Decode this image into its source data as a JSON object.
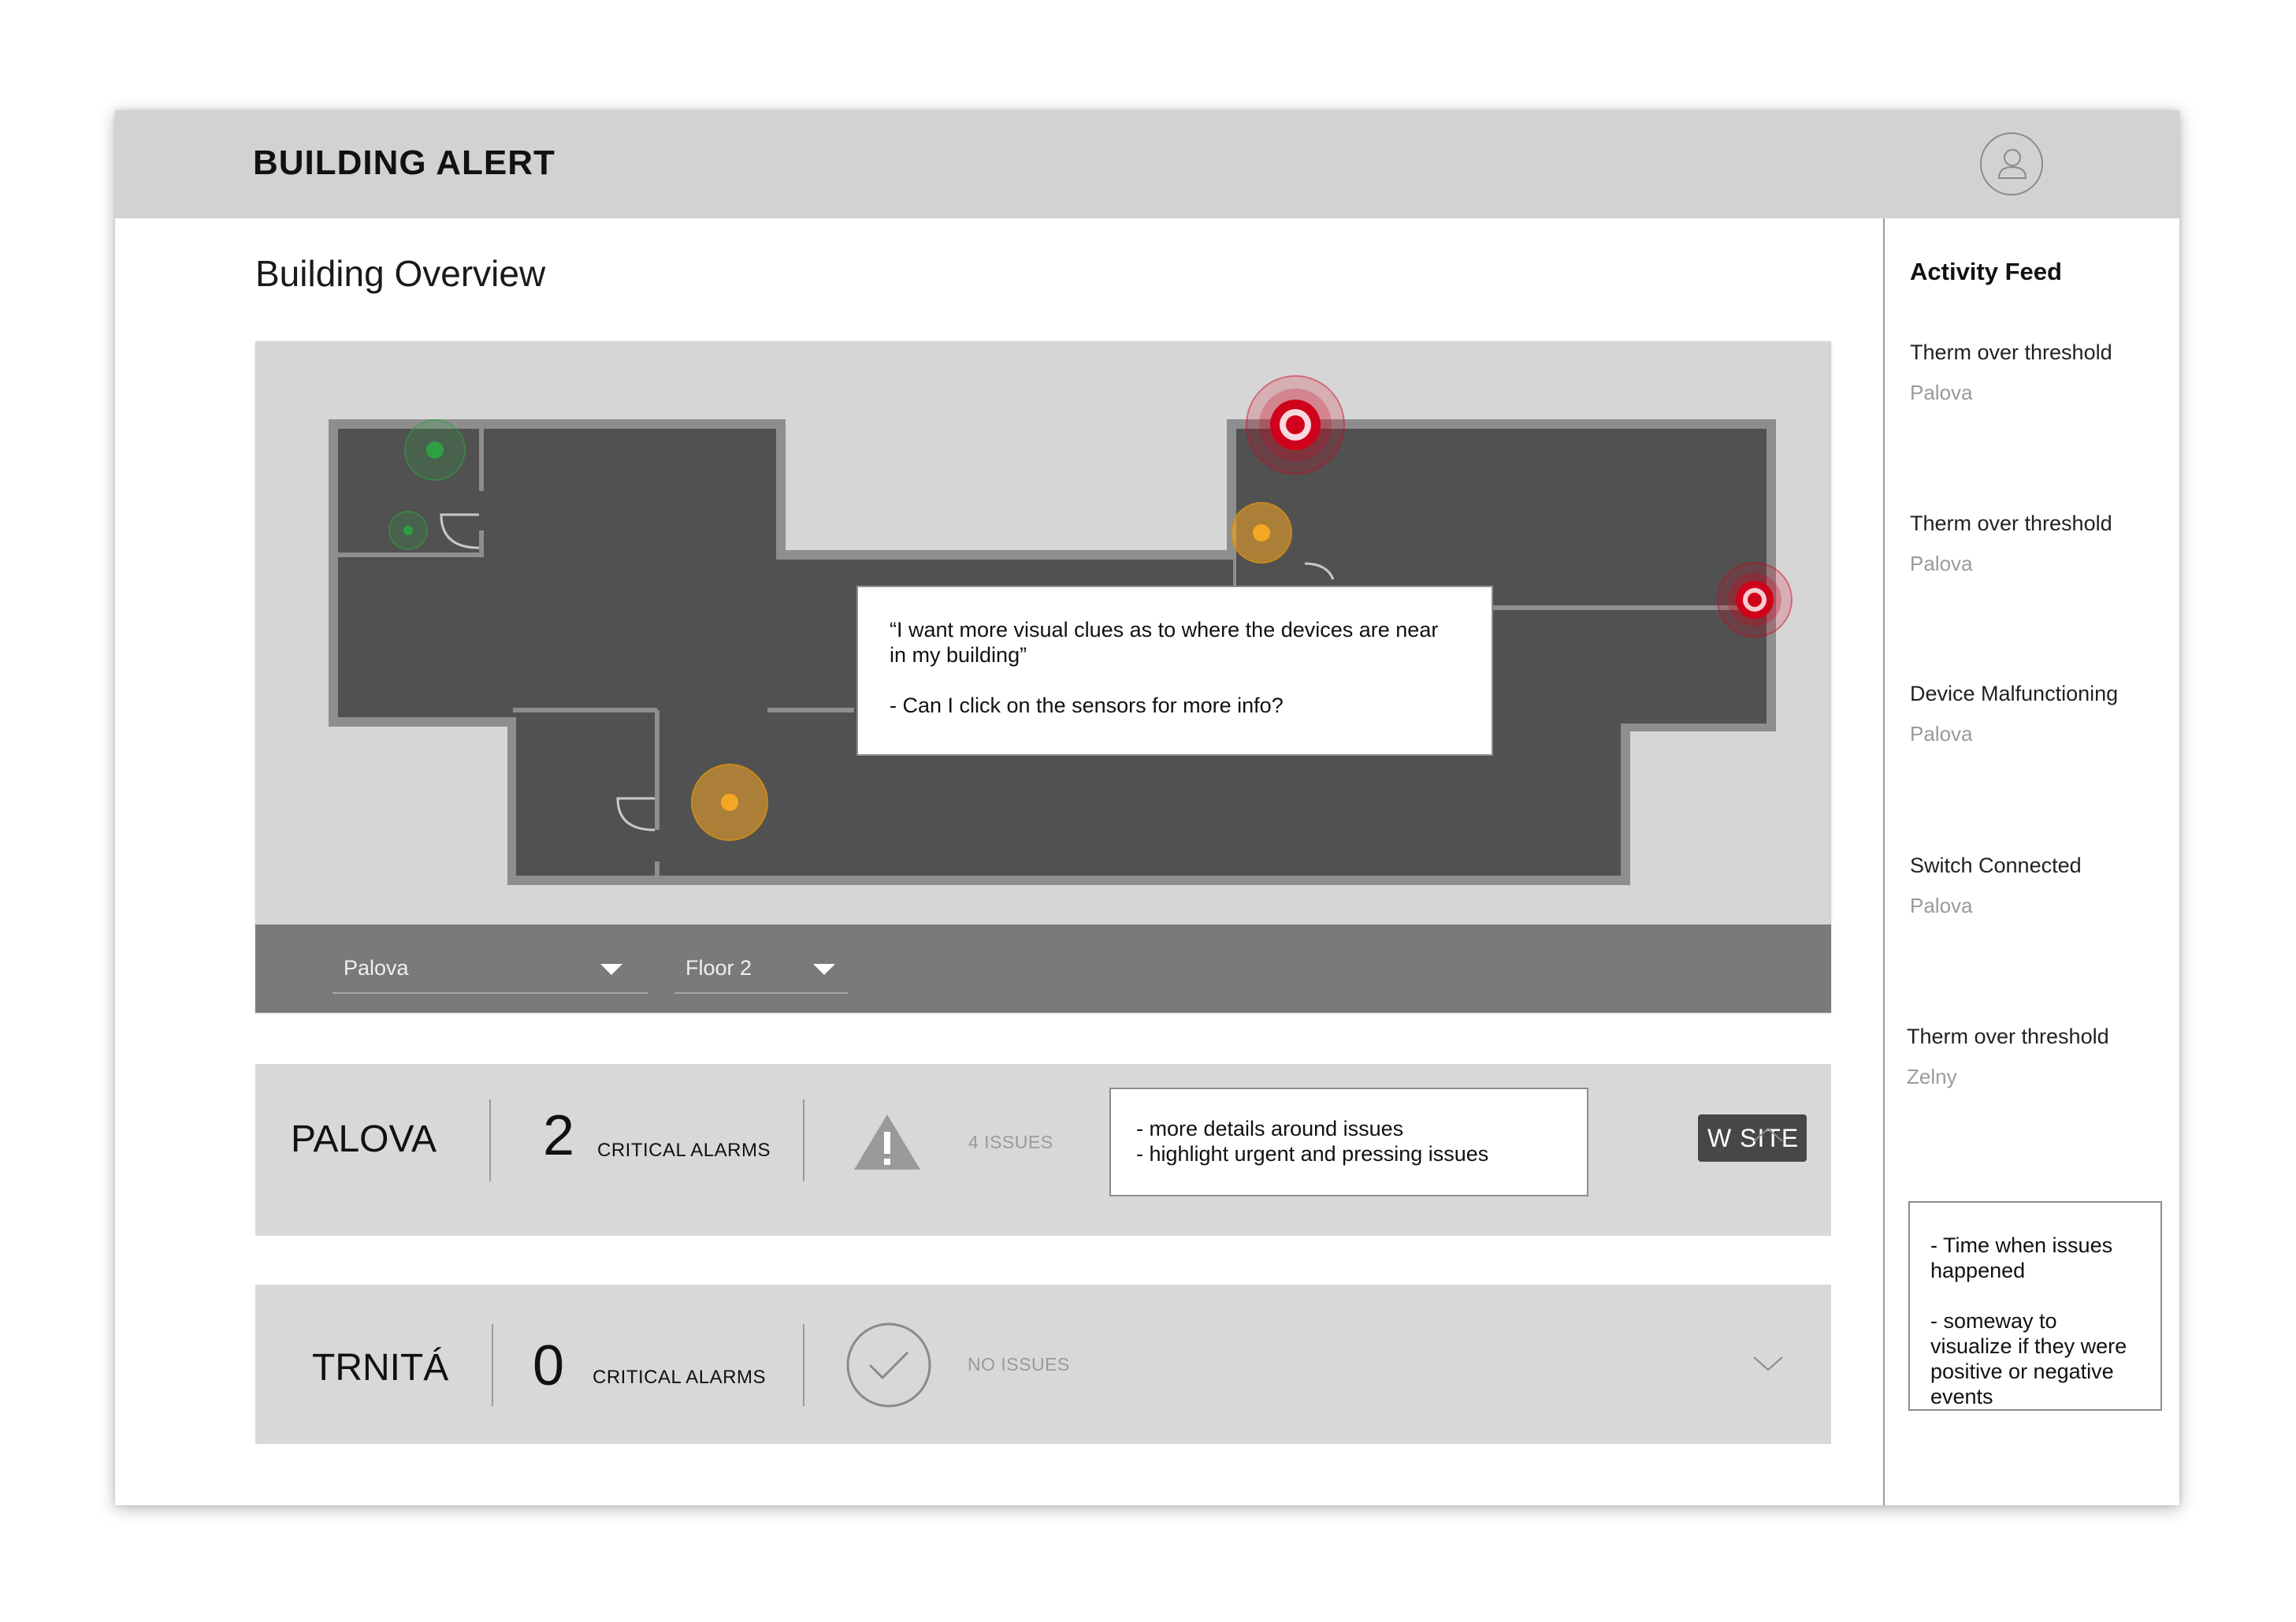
{
  "header": {
    "app_title": "BUILDING ALERT",
    "profile_icon": "user-profile-icon"
  },
  "main": {
    "page_title": "Building Overview",
    "map": {
      "site_select": {
        "value": "Palova"
      },
      "floor_select": {
        "value": "Floor 2"
      },
      "sensor_status_colors": {
        "ok": "#2ea043",
        "warning": "#f5a623",
        "critical": "#d0021b"
      }
    }
  },
  "sites": [
    {
      "name": "PALOVA",
      "critical_count": "2",
      "critical_label": "CRITICAL ALARMS",
      "issues_label": "4 ISSUES",
      "status_icon": "warning-triangle-icon",
      "view_button": "W SITE",
      "expanded": true,
      "chevron_icon": "chevron-up-icon"
    },
    {
      "name": "TRNITÁ",
      "critical_count": "0",
      "critical_label": "CRITICAL ALARMS",
      "issues_label": "NO ISSUES",
      "status_icon": "check-circle-icon",
      "expanded": false,
      "chevron_icon": "chevron-down-icon"
    }
  ],
  "activity_feed": {
    "title": "Activity Feed",
    "items": [
      {
        "event": "Therm over threshold",
        "site": "Palova"
      },
      {
        "event": "Therm over threshold",
        "site": "Palova"
      },
      {
        "event": "Device Malfunctioning",
        "site": "Palova"
      },
      {
        "event": "Switch Connected",
        "site": "Palova"
      },
      {
        "event": "Therm over threshold",
        "site": "Zelny"
      }
    ]
  },
  "annotations": {
    "map_note": "“I want more visual clues as to where the devices are near in my building”\n\n- Can I click on the sensors for more info?",
    "issues_note": "- more details around issues\n- highlight urgent and pressing issues",
    "feed_note": "- Time when issues happened\n\n- someway to visualize if they were positive or negative events"
  }
}
